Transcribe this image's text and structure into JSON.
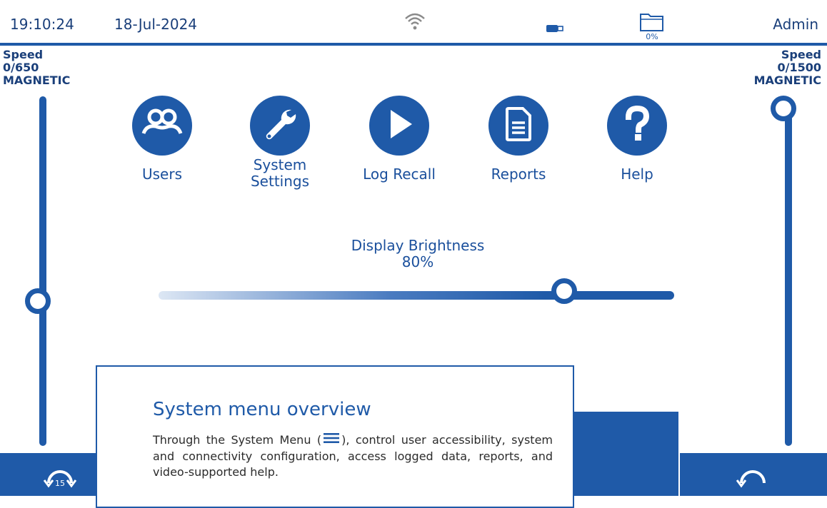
{
  "status_bar": {
    "time": "19:10:24",
    "date": "18-Jul-2024",
    "storage_percent": "0%",
    "user": "Admin",
    "icons": [
      "wifi-icon",
      "usb-battery-icon",
      "folder-icon"
    ]
  },
  "left_speed": {
    "line1": "Speed",
    "line2": "0/650",
    "line3": "MAGNETIC",
    "level": 0.35
  },
  "right_speed": {
    "line1": "Speed",
    "line2": "0/1500",
    "line3": "MAGNETIC",
    "level": 1.0
  },
  "menu": {
    "items": [
      {
        "label_line1": "",
        "label_line2": "Users",
        "icon": "users-icon"
      },
      {
        "label_line1": "System",
        "label_line2": "Settings",
        "icon": "wrench-icon"
      },
      {
        "label_line1": "",
        "label_line2": "Log Recall",
        "icon": "play-icon"
      },
      {
        "label_line1": "",
        "label_line2": "Reports",
        "icon": "document-icon"
      },
      {
        "label_line1": "",
        "label_line2": "Help",
        "icon": "question-icon"
      }
    ]
  },
  "brightness": {
    "title": "Display Brightness",
    "value_label": "80%",
    "value": 0.8
  },
  "bottom_bar": {
    "left_badge": "15"
  },
  "overview": {
    "title": "System menu overview",
    "text_before": "Through the System Menu (",
    "text_after": "), control user accessibility, system and connectivity configuration, access logged data, reports, and video-supported help."
  },
  "colors": {
    "primary": "#1f5aa8",
    "text": "#1a4f9c",
    "background": "#ffffff"
  }
}
